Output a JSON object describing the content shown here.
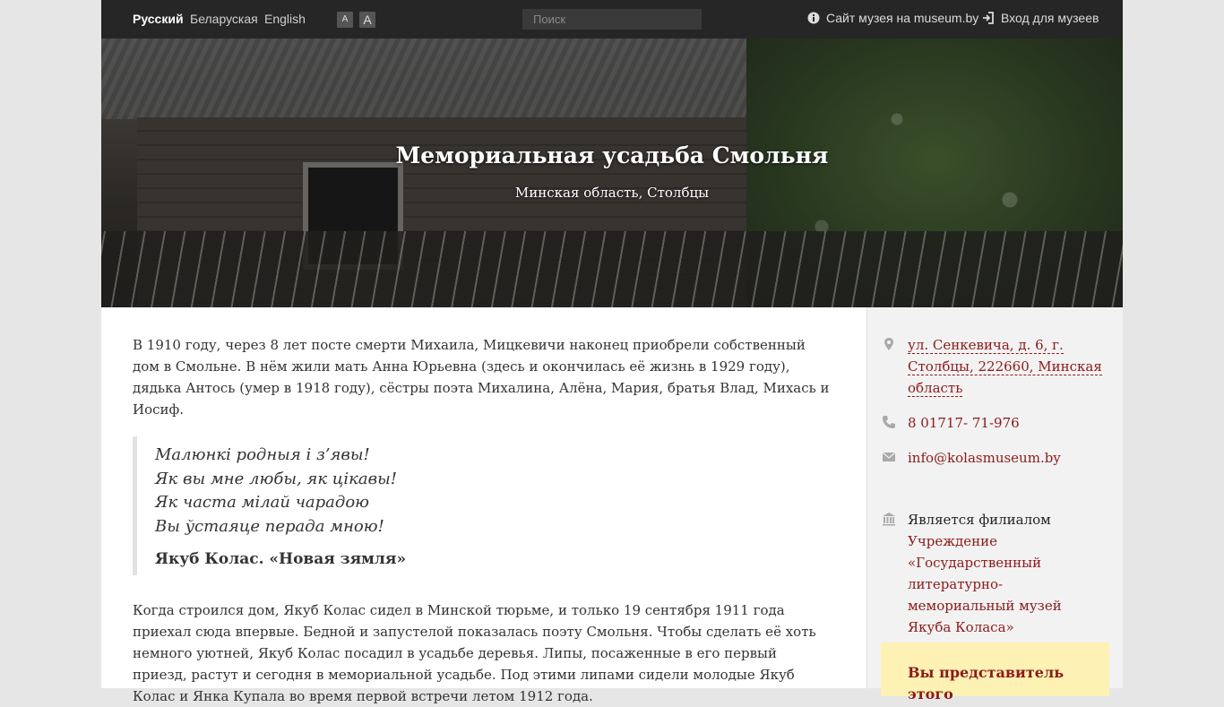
{
  "topbar": {
    "languages": [
      {
        "label": "Русский",
        "active": true
      },
      {
        "label": "Беларуская",
        "active": false
      },
      {
        "label": "English",
        "active": false
      }
    ],
    "font_smaller_label": "A",
    "font_larger_label": "A",
    "search_placeholder": "Поиск",
    "museum_site_label": "Сайт музея на museum.by",
    "login_label": "Вход для музеев"
  },
  "hero": {
    "title": "Мемориальная усадьба Смольня",
    "location": "Минская область, Столбцы"
  },
  "main": {
    "para1": "В 1910 году, через 8 лет посте смерти Михаила, Мицкевичи наконец приобрели собственный дом в Смольне. В нём жили мать Анна Юрьевна (здесь и окончилась её жизнь в 1929 году), дядька Антось (умер в 1918 году), сёстры поэта Михалина, Алёна, Мария, братья Влад, Михась и Иосиф.",
    "quote_lines": [
      "Малюнкі родныя і з’явы!",
      "Як вы мне любы, як цікавы!",
      "Як часта мілай чарадою",
      "Вы ўстаяце перада мною!"
    ],
    "quote_author": "Якуб Колас.",
    "quote_work": "«Новая зямля»",
    "para2": "Когда строился дом, Якуб Колас сидел в Минской тюрьме, и только 19 сентября 1911 года приехал сюда впервые. Бедной и запустелой показалась поэту Смольня. Чтобы сделать её хоть немного уютней, Якуб Колас посадил в усадьбе деревья. Липы, посаженные в его первый приезд, растут и сегодня в мемориальной усадьбе. Под этими липами сидели молодые Якуб Колас и Янка Купала во время первой встречи летом 1912 года."
  },
  "sidebar": {
    "address": "ул. Сенкевича, д. 6, г. Столбцы, 222660, Минская область",
    "phone": "8 01717- 71-976",
    "email": "info@kolasmuseum.by",
    "branch_label": "Является филиалом",
    "branch_parent": "Учреждение «Государственный литературно-мемориальный музей Якуба Коласа»",
    "notice": "Вы представитель этого"
  },
  "colors": {
    "link": "#8b1a1a",
    "topbar_bg": "#262626",
    "notice_bg": "#fdf1b3"
  }
}
